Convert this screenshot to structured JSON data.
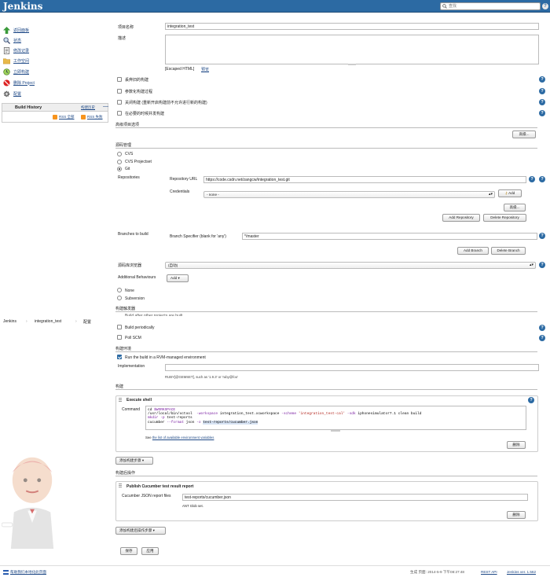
{
  "header": {
    "logo": "Jenkins",
    "search_placeholder": "查找",
    "help": "?"
  },
  "sidebar": {
    "items": [
      {
        "label": "返回面板",
        "icon": "up-arrow-icon"
      },
      {
        "label": "状态",
        "icon": "magnifier-icon"
      },
      {
        "label": "修改记录",
        "icon": "notepad-icon"
      },
      {
        "label": "工作空间",
        "icon": "folder-icon"
      },
      {
        "label": "立即构建",
        "icon": "clock-icon"
      },
      {
        "label": "删除 Project",
        "icon": "no-entry-icon"
      },
      {
        "label": "配置",
        "icon": "gear-icon"
      }
    ],
    "history": {
      "title": "Build History",
      "trend": "构建历史",
      "minus": "—",
      "rss_all": "RSS 全部",
      "rss_fail": "RSS 失败"
    }
  },
  "breadcrumb": {
    "root": "Jenkins",
    "project": "integration_test",
    "page": "配置",
    "sep": "›"
  },
  "form": {
    "project_name_label": "项目名称",
    "project_name_value": "integration_test",
    "description_label": "描述",
    "escaped_html": "[Escaped HTML]",
    "preview": "预览",
    "opt1": "丢弃旧的构建",
    "opt2": "参数化构建过程",
    "opt3": "关闭构建 (重新开启构建前不允许进行新的构建)",
    "opt4": "在必要的时候并发构建",
    "advanced_project": "高级项目选项",
    "advanced_btn": "高级...",
    "scm_title": "源码管理",
    "scm_cvs": "CVS",
    "scm_cvs_projectset": "CVS Projectset",
    "scm_git": "Git",
    "repositories": "Repositories",
    "repo_url_label": "Repository URL",
    "repo_url_value": "https://code.csdn.net/zangcw/integration_test.git",
    "credentials_label": "Credentials",
    "credentials_value": "- none -",
    "add_btn": "Add",
    "advanced_btn2": "高级...",
    "add_repo_btn": "Add Repository",
    "delete_repo_btn": "Delete Repository",
    "branches_label": "Branches to build",
    "branch_spec_label": "Branch Specifier (blank for 'any')",
    "branch_spec_value": "*/master",
    "add_branch_btn": "Add Branch",
    "delete_branch_btn": "Delete Branch",
    "repo_browser_label": "源码库浏览器",
    "repo_browser_value": "(自动)",
    "additional_label": "Additional Behaviours",
    "additional_add": "Add",
    "scm_none": "None",
    "scm_subversion": "Subversion",
    "triggers_title": "构建触发器",
    "trigger_overlap": "Build after other projects are built",
    "trigger_periodic": "Build periodically",
    "trigger_poll": "Poll SCM",
    "env_title": "构建环境",
    "env_rvm": "Run the build in a RVM-managed environment",
    "implementation_label": "Implementation",
    "implementation_hint": "RUBY[@GEMSET], such as '1.9.3' or 'ruby@foo'",
    "build_title": "构建",
    "execute_shell": "Execute shell",
    "command_label": "Command",
    "env_vars_pre": "See ",
    "env_vars_link": "the list of available environment variables",
    "delete_btn": "删除",
    "add_build_step": "添加构建步骤",
    "post_title": "构建后操作",
    "publish_cucumber": "Publish Cucumber test result report",
    "cucumber_label": "Cucumber JSON report files",
    "cucumber_value": "test-reports/cucumber.json",
    "ant_glob": "ANT Glob set.",
    "delete_btn2": "删除",
    "add_post_step": "添加构建后操作步骤",
    "save_btn": "保存",
    "apply_btn": "应用"
  },
  "command_lines": {
    "l1a": "cd ",
    "l1b": "$WORKSPACE",
    "l2a": "/usr/local/bin/xctool  ",
    "l2b": "-workspace",
    "l2c": " integration_test.xcworkspace ",
    "l2d": "-scheme",
    "l2e": " ",
    "l2f": "'integration_test-cal'",
    "l2g": " ",
    "l2h": "-sdk",
    "l2i": " iphonesimulator7.1 clean build",
    "l3a": "mkdir",
    "l3b": " ",
    "l3c": "-p",
    "l3d": " test-reports",
    "l4a": "cucumber ",
    "l4b": "--format",
    "l4c": " json ",
    "l4d": "-o",
    "l4e": " ",
    "l4f": "test-reports/cucumber.json"
  },
  "footer": {
    "help_link": "帮助我们本地化此页面",
    "generated": "生成 页面: 2014-5-9 下午08:27:48",
    "rest_api": "REST API",
    "version": "Jenkins ver. 1.562"
  }
}
